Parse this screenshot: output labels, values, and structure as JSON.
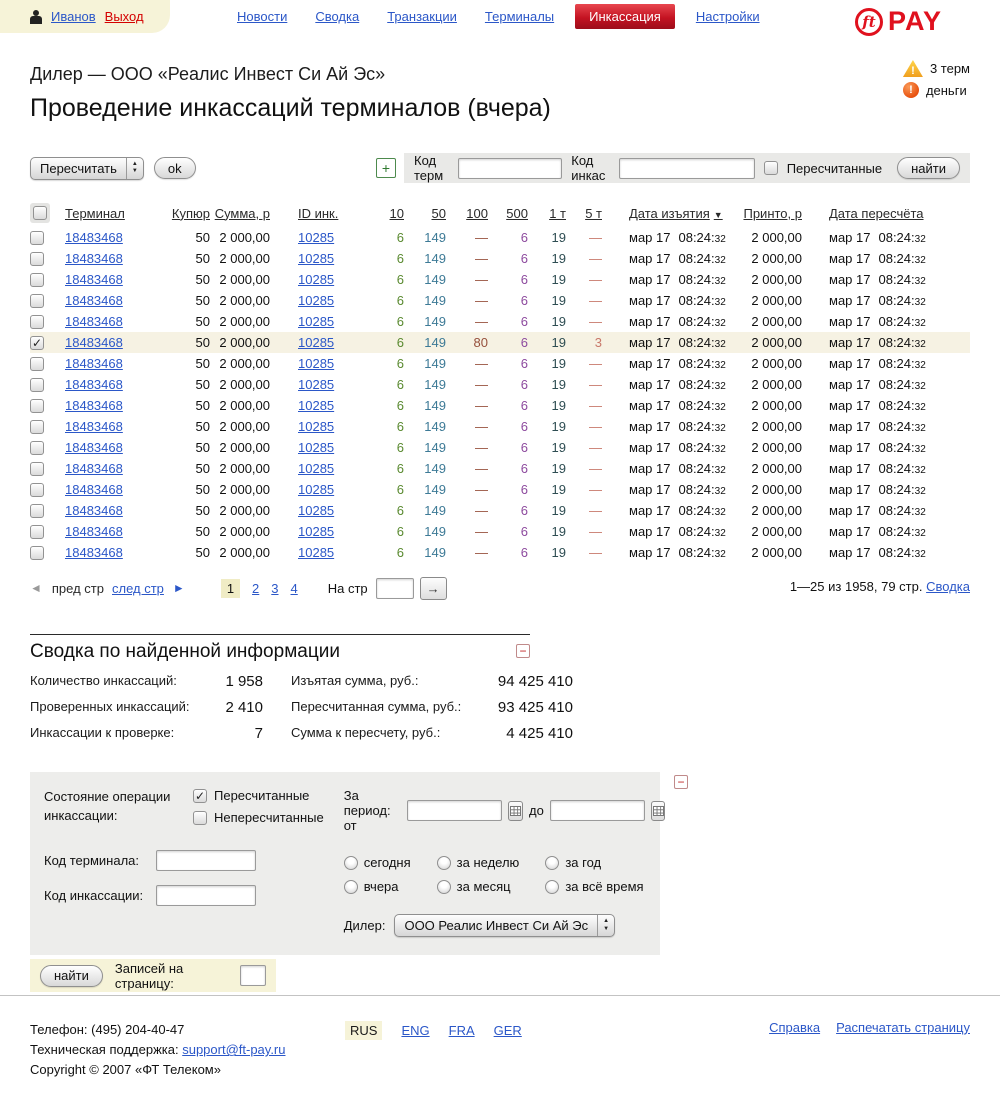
{
  "colors": {
    "link_blue": "#2b57c8",
    "brand_red": "#e0111e",
    "nav_active_red": "#c41322",
    "cream": "#f6f3d8",
    "checked_row": "#f6f2e3",
    "col_10": "#5a8a30",
    "col_50": "#3d7a96",
    "col_100": "#96503c",
    "col_500": "#8d4a9e",
    "col_1t": "#2e4d52",
    "col_5t": "#c8786a"
  },
  "topbar": {
    "user": "Иванов",
    "logout": "Выход",
    "nav": [
      {
        "label": "Новости",
        "active": false
      },
      {
        "label": "Сводка",
        "active": false
      },
      {
        "label": "Транзакции",
        "active": false
      },
      {
        "label": "Терминалы",
        "active": false
      },
      {
        "label": "Инкассация",
        "active": true
      },
      {
        "label": "Настройки",
        "active": false
      }
    ],
    "logo_circle": "ft",
    "logo_text": "PAY"
  },
  "header": {
    "dealer_line": "Дилер — ООО «Реалис Инвест Си Ай Эс»",
    "page_title": "Проведение инкассаций терминалов (вчера)",
    "alert_terms": "3 терм",
    "alert_money": "деньги"
  },
  "toolbar": {
    "bulk_action": "Пересчитать",
    "ok": "ok",
    "add": "+",
    "term_code_label": "Код терм",
    "collect_code_label": "Код инкас",
    "recounted_checkbox": "Пересчитанные",
    "find": "найти"
  },
  "table": {
    "headers": {
      "terminal": "Терминал",
      "bills": "Купюр",
      "sum": "Сумма, р",
      "id": "ID инк.",
      "c10": "10",
      "c50": "50",
      "c100": "100",
      "c500": "500",
      "c1t": "1 т",
      "c5t": "5 т",
      "date_seized": "Дата изъятия",
      "sort_icon": "▼",
      "printed": "Принто, р",
      "date_recount": "Дата пересчёта"
    },
    "rows": [
      {
        "checked": false,
        "terminal": "18483468",
        "bills": "50",
        "sum": "2 000,00",
        "id": "10285",
        "c10": "6",
        "c50": "149",
        "c100": "—",
        "c500": "6",
        "c1t": "19",
        "c5t": "—",
        "d1": "мар 17",
        "t1": "08:24:",
        "s1": "32",
        "printed": "2 000,00",
        "d2": "мар 17",
        "t2": "08:24:",
        "s2": "32"
      },
      {
        "checked": false,
        "terminal": "18483468",
        "bills": "50",
        "sum": "2 000,00",
        "id": "10285",
        "c10": "6",
        "c50": "149",
        "c100": "—",
        "c500": "6",
        "c1t": "19",
        "c5t": "—",
        "d1": "мар 17",
        "t1": "08:24:",
        "s1": "32",
        "printed": "2 000,00",
        "d2": "мар 17",
        "t2": "08:24:",
        "s2": "32"
      },
      {
        "checked": false,
        "terminal": "18483468",
        "bills": "50",
        "sum": "2 000,00",
        "id": "10285",
        "c10": "6",
        "c50": "149",
        "c100": "—",
        "c500": "6",
        "c1t": "19",
        "c5t": "—",
        "d1": "мар 17",
        "t1": "08:24:",
        "s1": "32",
        "printed": "2 000,00",
        "d2": "мар 17",
        "t2": "08:24:",
        "s2": "32"
      },
      {
        "checked": false,
        "terminal": "18483468",
        "bills": "50",
        "sum": "2 000,00",
        "id": "10285",
        "c10": "6",
        "c50": "149",
        "c100": "—",
        "c500": "6",
        "c1t": "19",
        "c5t": "—",
        "d1": "мар 17",
        "t1": "08:24:",
        "s1": "32",
        "printed": "2 000,00",
        "d2": "мар 17",
        "t2": "08:24:",
        "s2": "32"
      },
      {
        "checked": false,
        "terminal": "18483468",
        "bills": "50",
        "sum": "2 000,00",
        "id": "10285",
        "c10": "6",
        "c50": "149",
        "c100": "—",
        "c500": "6",
        "c1t": "19",
        "c5t": "—",
        "d1": "мар 17",
        "t1": "08:24:",
        "s1": "32",
        "printed": "2 000,00",
        "d2": "мар 17",
        "t2": "08:24:",
        "s2": "32"
      },
      {
        "checked": true,
        "terminal": "18483468",
        "bills": "50",
        "sum": "2 000,00",
        "id": "10285",
        "c10": "6",
        "c50": "149",
        "c100": "80",
        "c500": "6",
        "c1t": "19",
        "c5t": "3",
        "d1": "мар 17",
        "t1": "08:24:",
        "s1": "32",
        "printed": "2 000,00",
        "d2": "мар 17",
        "t2": "08:24:",
        "s2": "32"
      },
      {
        "checked": false,
        "terminal": "18483468",
        "bills": "50",
        "sum": "2 000,00",
        "id": "10285",
        "c10": "6",
        "c50": "149",
        "c100": "—",
        "c500": "6",
        "c1t": "19",
        "c5t": "—",
        "d1": "мар 17",
        "t1": "08:24:",
        "s1": "32",
        "printed": "2 000,00",
        "d2": "мар 17",
        "t2": "08:24:",
        "s2": "32"
      },
      {
        "checked": false,
        "terminal": "18483468",
        "bills": "50",
        "sum": "2 000,00",
        "id": "10285",
        "c10": "6",
        "c50": "149",
        "c100": "—",
        "c500": "6",
        "c1t": "19",
        "c5t": "—",
        "d1": "мар 17",
        "t1": "08:24:",
        "s1": "32",
        "printed": "2 000,00",
        "d2": "мар 17",
        "t2": "08:24:",
        "s2": "32"
      },
      {
        "checked": false,
        "terminal": "18483468",
        "bills": "50",
        "sum": "2 000,00",
        "id": "10285",
        "c10": "6",
        "c50": "149",
        "c100": "—",
        "c500": "6",
        "c1t": "19",
        "c5t": "—",
        "d1": "мар 17",
        "t1": "08:24:",
        "s1": "32",
        "printed": "2 000,00",
        "d2": "мар 17",
        "t2": "08:24:",
        "s2": "32"
      },
      {
        "checked": false,
        "terminal": "18483468",
        "bills": "50",
        "sum": "2 000,00",
        "id": "10285",
        "c10": "6",
        "c50": "149",
        "c100": "—",
        "c500": "6",
        "c1t": "19",
        "c5t": "—",
        "d1": "мар 17",
        "t1": "08:24:",
        "s1": "32",
        "printed": "2 000,00",
        "d2": "мар 17",
        "t2": "08:24:",
        "s2": "32"
      },
      {
        "checked": false,
        "terminal": "18483468",
        "bills": "50",
        "sum": "2 000,00",
        "id": "10285",
        "c10": "6",
        "c50": "149",
        "c100": "—",
        "c500": "6",
        "c1t": "19",
        "c5t": "—",
        "d1": "мар 17",
        "t1": "08:24:",
        "s1": "32",
        "printed": "2 000,00",
        "d2": "мар 17",
        "t2": "08:24:",
        "s2": "32"
      },
      {
        "checked": false,
        "terminal": "18483468",
        "bills": "50",
        "sum": "2 000,00",
        "id": "10285",
        "c10": "6",
        "c50": "149",
        "c100": "—",
        "c500": "6",
        "c1t": "19",
        "c5t": "—",
        "d1": "мар 17",
        "t1": "08:24:",
        "s1": "32",
        "printed": "2 000,00",
        "d2": "мар 17",
        "t2": "08:24:",
        "s2": "32"
      },
      {
        "checked": false,
        "terminal": "18483468",
        "bills": "50",
        "sum": "2 000,00",
        "id": "10285",
        "c10": "6",
        "c50": "149",
        "c100": "—",
        "c500": "6",
        "c1t": "19",
        "c5t": "—",
        "d1": "мар 17",
        "t1": "08:24:",
        "s1": "32",
        "printed": "2 000,00",
        "d2": "мар 17",
        "t2": "08:24:",
        "s2": "32"
      },
      {
        "checked": false,
        "terminal": "18483468",
        "bills": "50",
        "sum": "2 000,00",
        "id": "10285",
        "c10": "6",
        "c50": "149",
        "c100": "—",
        "c500": "6",
        "c1t": "19",
        "c5t": "—",
        "d1": "мар 17",
        "t1": "08:24:",
        "s1": "32",
        "printed": "2 000,00",
        "d2": "мар 17",
        "t2": "08:24:",
        "s2": "32"
      },
      {
        "checked": false,
        "terminal": "18483468",
        "bills": "50",
        "sum": "2 000,00",
        "id": "10285",
        "c10": "6",
        "c50": "149",
        "c100": "—",
        "c500": "6",
        "c1t": "19",
        "c5t": "—",
        "d1": "мар 17",
        "t1": "08:24:",
        "s1": "32",
        "printed": "2 000,00",
        "d2": "мар 17",
        "t2": "08:24:",
        "s2": "32"
      },
      {
        "checked": false,
        "terminal": "18483468",
        "bills": "50",
        "sum": "2 000,00",
        "id": "10285",
        "c10": "6",
        "c50": "149",
        "c100": "—",
        "c500": "6",
        "c1t": "19",
        "c5t": "—",
        "d1": "мар 17",
        "t1": "08:24:",
        "s1": "32",
        "printed": "2 000,00",
        "d2": "мар 17",
        "t2": "08:24:",
        "s2": "32"
      }
    ]
  },
  "pagination": {
    "prev_icon": "◄",
    "prev": "пред стр",
    "next": "след стр",
    "next_icon": "►",
    "pages": [
      "1",
      "2",
      "3",
      "4"
    ],
    "goto_label": "На стр",
    "goto_button": "→",
    "range_info": "1—25 из 1958, 79 стр.",
    "range_link": "Сводка"
  },
  "summary": {
    "title": "Сводка по найденной информации",
    "collapse": "−",
    "left": [
      {
        "label": "Количество инкассаций:",
        "value": "1 958"
      },
      {
        "label": "Проверенных инкассаций:",
        "value": "2 410"
      },
      {
        "label": "Инкассации к проверке:",
        "value": "7"
      }
    ],
    "right": [
      {
        "label": "Изъятая сумма, руб.:",
        "value": "94 425 410"
      },
      {
        "label": "Пересчитанная сумма, руб.:",
        "value": "93 425 410"
      },
      {
        "label": "Сумма к пересчету, руб.:",
        "value": "4 425 410"
      }
    ]
  },
  "filter": {
    "state_label": "Состояние операции инкассации:",
    "recounted": "Пересчитанные",
    "not_recounted": "Непересчитанные",
    "term_code_label": "Код терминала:",
    "collect_code_label": "Код инкассации:",
    "period_label": "За период: от",
    "period_to": "до",
    "radios": [
      "сегодня",
      "вчера",
      "за неделю",
      "за месяц",
      "за год",
      "за всё время"
    ],
    "dealer_label": "Дилер:",
    "dealer_value": "ООО Реалис Инвест Си Ай Эс",
    "collapse": "−",
    "find": "найти",
    "per_page_label": "Записей на страницу:"
  },
  "footer": {
    "phone": "Телефон: (495) 204-40-47",
    "support_label": "Техническая поддержка:",
    "support_link": "support@ft-pay.ru",
    "copyright": "Copyright © 2007 «ФТ Телеком»",
    "langs": [
      {
        "label": "RUS",
        "active": true
      },
      {
        "label": "ENG",
        "active": false
      },
      {
        "label": "FRA",
        "active": false
      },
      {
        "label": "GER",
        "active": false
      }
    ],
    "help": "Справка",
    "print": "Распечатать страницу"
  }
}
